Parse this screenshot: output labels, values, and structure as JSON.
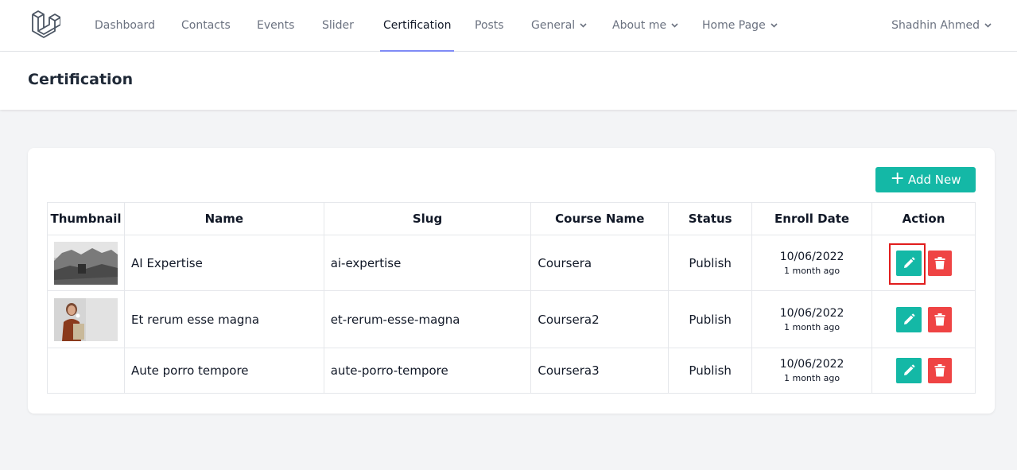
{
  "nav": {
    "items": [
      {
        "label": "Dashboard"
      },
      {
        "label": "Contacts"
      },
      {
        "label": "Events"
      },
      {
        "label": "Slider"
      },
      {
        "label": "Certification"
      },
      {
        "label": "Posts"
      },
      {
        "label": "General"
      },
      {
        "label": "About me"
      },
      {
        "label": "Home Page"
      }
    ],
    "active": "Certification",
    "user": "Shadhin Ahmed"
  },
  "header": {
    "title": "Certification"
  },
  "toolbar": {
    "add_label": "Add New"
  },
  "table": {
    "columns": [
      "Thumbnail",
      "Name",
      "Slug",
      "Course Name",
      "Status",
      "Enroll Date",
      "Action"
    ],
    "rows": [
      {
        "name": "AI Expertise",
        "slug": "ai-expertise",
        "course": "Coursera",
        "status": "Publish",
        "date": "10/06/2022",
        "relative": "1 month ago"
      },
      {
        "name": "Et rerum esse magna",
        "slug": "et-rerum-esse-magna",
        "course": "Coursera2",
        "status": "Publish",
        "date": "10/06/2022",
        "relative": "1 month ago"
      },
      {
        "name": "Aute porro tempore",
        "slug": "aute-porro-tempore",
        "course": "Coursera3",
        "status": "Publish",
        "date": "10/06/2022",
        "relative": "1 month ago"
      }
    ]
  },
  "colors": {
    "accent": "#14b8a6",
    "danger": "#ef4444",
    "active_underline": "#818cf8",
    "highlight": "#e11d1d"
  }
}
